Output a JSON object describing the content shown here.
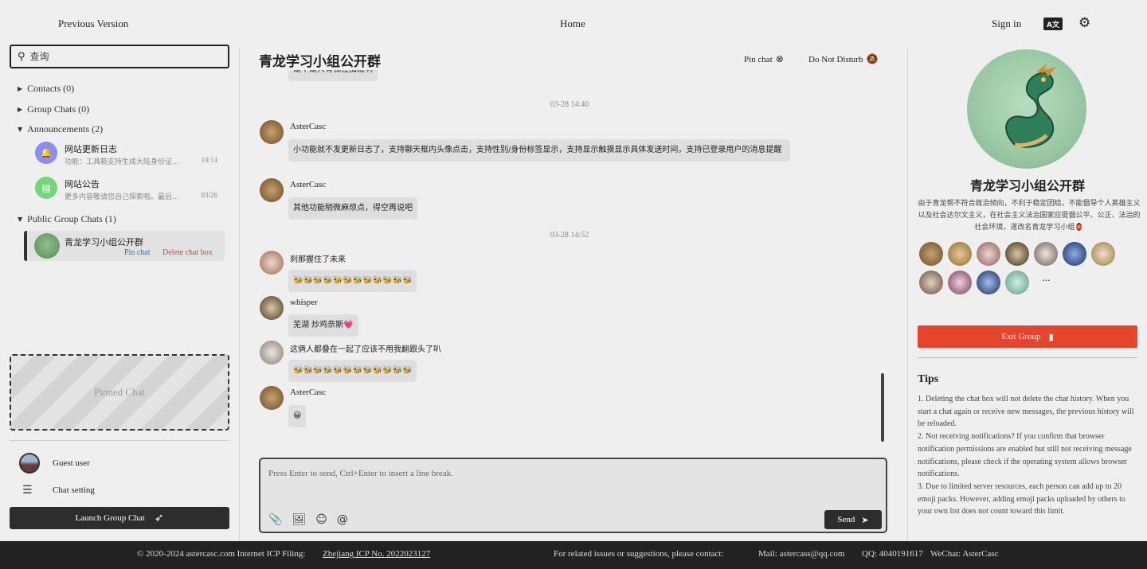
{
  "topbar": {
    "previous_version": "Previous Version",
    "home": "Home",
    "sign_in": "Sign in",
    "lang_badge": "A文",
    "settings_icon": "gear-icon"
  },
  "sidebar": {
    "search_placeholder": "查询",
    "sections": [
      {
        "label": "Contacts (0)",
        "expanded": false
      },
      {
        "label": "Group Chats (0)",
        "expanded": false
      },
      {
        "label": "Announcements (2)",
        "expanded": true
      },
      {
        "label": "Public Group Chats (1)",
        "expanded": true
      }
    ],
    "announcements": [
      {
        "name": "网站更新日志",
        "preview": "功能：工具箱支持生成大陆身份证...",
        "time": "10/14",
        "color": "#8c8cf2"
      },
      {
        "name": "网站公告",
        "preview": "更多内容敬请您自己探索啦。最后，...",
        "time": "03/26",
        "color": "#74d67c"
      }
    ],
    "public_group": {
      "name": "青龙学习小组公开群",
      "pin_label": "Pin chat",
      "delete_label": "Delete chat box"
    },
    "pinned_label": "Pinned Chat",
    "guest_label": "Guest user",
    "chat_setting_label": "Chat setting",
    "launch_label": "Launch Group Chat"
  },
  "chat": {
    "title": "青龙学习小组公开群",
    "pin_chat": "Pin chat",
    "do_not_disturb": "Do Not Disturb",
    "top_cut_message": "是不是只有我在加班啊",
    "timestamps": [
      "03-28 14:40",
      "03-28 14:52"
    ],
    "messages": [
      {
        "user": "AsterCasc",
        "text": "小功能就不发更新日志了，支持聊天框内头像点击，支持性别/身份标签显示，支持显示触摸显示具体发送时间，支持已登录用户的消息提醒"
      },
      {
        "user": "AsterCasc",
        "text": "其他功能稍微麻烦点，得空再说吧"
      },
      {
        "user": "刹那握住了未来",
        "text": "🐝🐝🐝🐝🐝🐝🐝🐝🐝🐝🐝🐝"
      },
      {
        "user": "whisper",
        "text": "芜湖  炒鸡奈斯💗"
      },
      {
        "user": "这俩人都叠在一起了应该不用我翻跟头了叭",
        "text": "🐝🐝🐝🐝🐝🐝🐝🐝🐝🐝🐝🐝"
      },
      {
        "user": "AsterCasc",
        "text": "😀"
      }
    ],
    "input_placeholder": "Press Enter to send, Ctrl+Enter to insert a line break.",
    "send_label": "Send"
  },
  "group_info": {
    "name": "青龙学习小组公开群",
    "description": "由于青龙帮不符合政治倾向，不利于稳定团结，不能倡导个人英雄主义以及社会达尔文主义，在社会主义法治国家应提倡公平、公正、法治的社会环境，遂改名青龙学习小组🏮",
    "more_members": "...",
    "exit_label": "Exit Group",
    "tips_title": "Tips",
    "tips": [
      "1. Deleting the chat box will not delete the chat history. When you start a chat again or receive new messages, the previous history will be reloaded.",
      "2. Not receiving notifications? If you confirm that browser notification permissions are enabled but still not receiving message notifications, please check if the operating system allows browser notifications.",
      "3. Due to limited server resources, each person can add up to 20 emoji packs. However, adding emoji packs uploaded by others to your own list does not count toward this limit."
    ]
  },
  "footer": {
    "copyright": "© 2020-2024 astercasc.com Internet ICP Filing:",
    "icp": "Zhejiang ICP No. 2022023127",
    "contact": "For related issues or suggestions, please contact:",
    "mail": "Mail: astercass@qq.com",
    "qq": "QQ: 4040191617",
    "wechat": "WeChat: AsterCasc"
  }
}
